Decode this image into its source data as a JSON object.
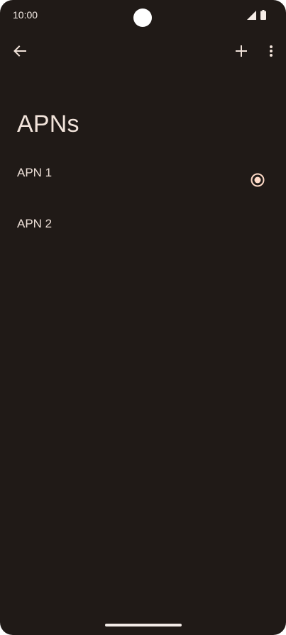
{
  "status_bar": {
    "time": "10:00",
    "signal_icon": "cell-signal-icon",
    "battery_icon": "battery-icon"
  },
  "toolbar": {
    "back_icon": "arrow-back-icon",
    "add_icon": "plus-icon",
    "more_icon": "more-vert-icon"
  },
  "page": {
    "title": "APNs"
  },
  "apns": [
    {
      "label": "APN 1",
      "selected": true
    },
    {
      "label": "APN 2",
      "selected": false
    }
  ],
  "colors": {
    "background": "#201a17",
    "text": "#ede0d8",
    "accent": "#ffdbc8"
  }
}
